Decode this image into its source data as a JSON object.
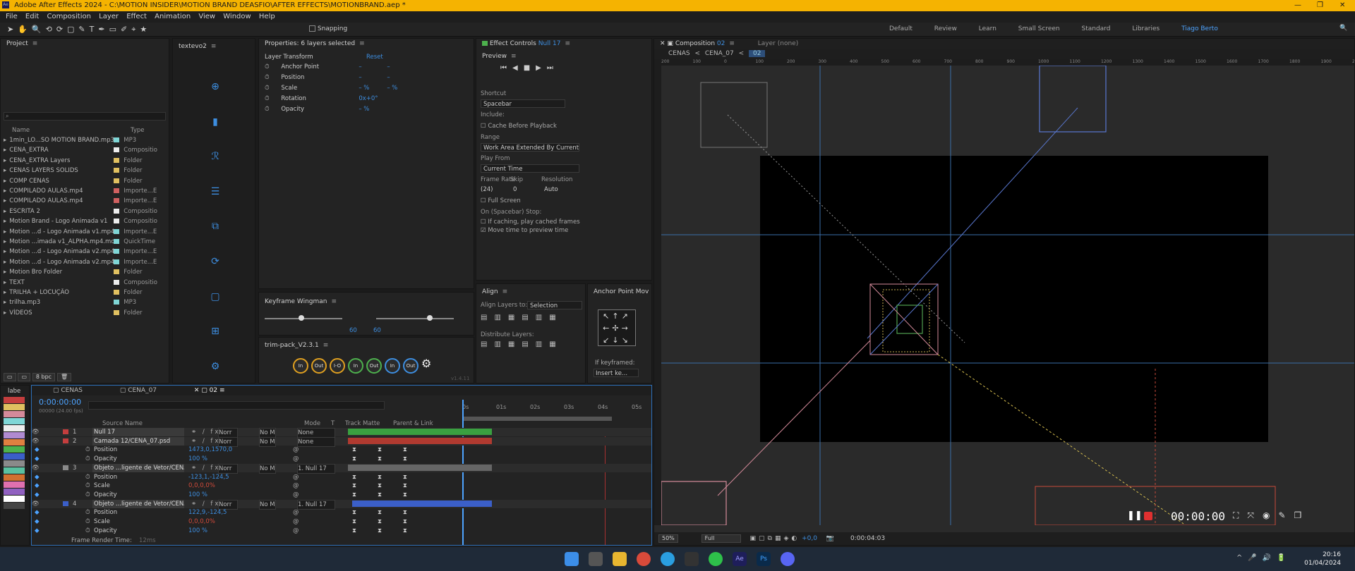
{
  "titlebar": {
    "title": "Adobe After Effects 2024 - C:\\MOTION INSIDER\\MOTION BRAND DEASFIO\\AFTER EFFECTS\\MOTIONBRAND.aep *"
  },
  "menu": [
    "File",
    "Edit",
    "Composition",
    "Layer",
    "Effect",
    "Animation",
    "View",
    "Window",
    "Help"
  ],
  "toolbar": {
    "snapping": "Snapping",
    "workspaces": [
      "Default",
      "Review",
      "Learn",
      "Small Screen",
      "Standard",
      "Libraries",
      "Tiago Berto"
    ],
    "active_workspace": "Tiago Berto"
  },
  "project": {
    "title": "Project",
    "search_placeholder": "",
    "col_name": "Name",
    "col_type": "Type",
    "items": [
      {
        "name": "1min_LO...SO MOTION BRAND.mp3",
        "type": "MP3",
        "color": "#7fd6d6"
      },
      {
        "name": "CENA_EXTRA",
        "type": "Compositio",
        "color": "#ededed"
      },
      {
        "name": "CENA_EXTRA Layers",
        "type": "Folder",
        "color": "#e0c060"
      },
      {
        "name": "CENAS LAYERS SOLIDS",
        "type": "Folder",
        "color": "#e0c060"
      },
      {
        "name": "COMP CENAS",
        "type": "Folder",
        "color": "#e0c060"
      },
      {
        "name": "COMPILADO AULAS.mp4",
        "type": "Importe...E",
        "color": "#d06060"
      },
      {
        "name": "COMPILADO AULAS.mp4",
        "type": "Importe...E",
        "color": "#d06060"
      },
      {
        "name": "ESCRITA 2",
        "type": "Compositio",
        "color": "#ededed"
      },
      {
        "name": "Motion Brand - Logo Animada v1",
        "type": "Compositio",
        "color": "#ededed"
      },
      {
        "name": "Motion ...d - Logo Animada v1.mp4",
        "type": "Importe...E",
        "color": "#7fd6d6"
      },
      {
        "name": "Motion ...imada v1_ALPHA.mp4.mov",
        "type": "QuickTime",
        "color": "#7fd6d6"
      },
      {
        "name": "Motion ...d - Logo Animada v2.mp4",
        "type": "Importe...E",
        "color": "#7fd6d6"
      },
      {
        "name": "Motion ...d - Logo Animada v2.mp4",
        "type": "Importe...E",
        "color": "#7fd6d6"
      },
      {
        "name": "Motion Bro Folder",
        "type": "Folder",
        "color": "#e0c060"
      },
      {
        "name": "TEXT",
        "type": "Compositio",
        "color": "#ededed"
      },
      {
        "name": "TRILHA + LOCUÇÃO",
        "type": "Folder",
        "color": "#e0c060"
      },
      {
        "name": "trilha.mp3",
        "type": "MP3",
        "color": "#7fd6d6"
      },
      {
        "name": "VÍDEOS",
        "type": "Folder",
        "color": "#e0c060"
      }
    ],
    "bpc": "8 bpc"
  },
  "textevo": {
    "title": "textevo2"
  },
  "properties": {
    "title": "Properties: 6 layers selected",
    "section": "Layer Transform",
    "reset": "Reset",
    "rows": [
      {
        "label": "Anchor Point",
        "v1": "–",
        "v2": "–"
      },
      {
        "label": "Position",
        "v1": "–",
        "v2": "–"
      },
      {
        "label": "Scale",
        "v1": "– %",
        "v2": "– %"
      },
      {
        "label": "Rotation",
        "v1": "0x+0°",
        "v2": ""
      },
      {
        "label": "Opacity",
        "v1": "– %",
        "v2": ""
      }
    ]
  },
  "effect_controls": {
    "title": "Effect Controls",
    "layer": "Null 17"
  },
  "preview": {
    "title": "Preview",
    "shortcut_label": "Shortcut",
    "shortcut_value": "Spacebar",
    "include_label": "Include:",
    "cache_label": "Cache Before Playback",
    "range_label": "Range",
    "range_value": "Work Area Extended By Current...",
    "playfrom_label": "Play From",
    "playfrom_value": "Current Time",
    "framerate_label": "Frame Rate",
    "skip_label": "Skip",
    "resolution_label": "Resolution",
    "framerate_value": "(24)",
    "skip_value": "0",
    "resolution_value": "Auto",
    "fullscreen_label": "Full Screen",
    "stop_label": "On (Spacebar) Stop:",
    "stop_opt1": "If caching, play cached frames",
    "stop_opt2": "Move time to preview time"
  },
  "keyframe_wingman": {
    "title": "Keyframe Wingman",
    "v1": "60",
    "v2": "60"
  },
  "trim_pack": {
    "title": "trim-pack_V2.3.1",
    "buttons": [
      "In",
      "Out",
      "I-O",
      "In",
      "Out",
      "In",
      "Out"
    ],
    "version": "v1.4.11"
  },
  "align": {
    "title": "Align",
    "align_to_label": "Align Layers to:",
    "align_to_value": "Selection",
    "distribute_label": "Distribute Layers:"
  },
  "anchor_point": {
    "title": "Anchor Point Mov",
    "if_keyframed": "If keyframed:",
    "insert": "Insert ke..."
  },
  "composition": {
    "title": "Composition",
    "comp_name": "02",
    "layer_panel": "Layer (none)",
    "breadcrumbs": [
      "CENAS",
      "CENA_07",
      "02"
    ],
    "zoom": "50%",
    "quality": "Full",
    "exposure": "+0,0",
    "timecode": "0:00:04:03",
    "ruler": [
      "200",
      "100",
      "0",
      "100",
      "200",
      "300",
      "400",
      "500",
      "600",
      "700",
      "800",
      "900",
      "1000",
      "1100",
      "1200",
      "1300",
      "1400",
      "1500",
      "1600",
      "1700",
      "1800",
      "1900",
      "2000"
    ]
  },
  "recorder": {
    "time": "00:00:00"
  },
  "timeline": {
    "tabs": [
      "CENAS",
      "CENA_07",
      "02"
    ],
    "active_tab": "02",
    "timecode": "0:00:00:00",
    "fps": "00000 (24.00 fps)",
    "columns": {
      "source": "Source Name",
      "mode": "Mode",
      "t": "T",
      "track": "Track Matte",
      "parent": "Parent & Link"
    },
    "ticks": [
      "0s",
      "01s",
      "02s",
      "03s",
      "04s",
      "05s"
    ],
    "layers": [
      {
        "num": "1",
        "name": "Null 17",
        "mode": "Norr",
        "track": "No M",
        "parent": "None",
        "color": "#c43e3e"
      },
      {
        "num": "2",
        "name": "Camada 12/CENA_07.psd",
        "mode": "Norr",
        "track": "No M",
        "parent": "None",
        "color": "#c43e3e"
      },
      {
        "num": "3",
        "name": "Objeto ...ligente de Vetor/CENA_07.psd",
        "mode": "Norr",
        "track": "No M",
        "parent": "1. Null 17",
        "color": "#8a8a8a"
      },
      {
        "num": "4",
        "name": "Objeto ...ligente de Vetor/CENA_07.psd",
        "mode": "Norr",
        "track": "No M",
        "parent": "1. Null 17",
        "color": "#3b5fc8"
      }
    ],
    "props": [
      {
        "label": "Position",
        "value": "1473,0,1570,0",
        "color": "#3d8ee0"
      },
      {
        "label": "Opacity",
        "value": "100 %",
        "color": "#3d8ee0"
      },
      {
        "label": "Position",
        "value": "-123,1,-124,5",
        "color": "#3d8ee0"
      },
      {
        "label": "Scale",
        "value": "0,0,0,0%",
        "color": "#d04a3a"
      },
      {
        "label": "Opacity",
        "value": "100 %",
        "color": "#3d8ee0"
      },
      {
        "label": "Position",
        "value": "122,9,-124,5",
        "color": "#3d8ee0"
      },
      {
        "label": "Scale",
        "value": "0,0,0,0%",
        "color": "#d04a3a"
      },
      {
        "label": "Opacity",
        "value": "100 %",
        "color": "#3d8ee0"
      }
    ],
    "frame_render": "Frame Render Time:",
    "frame_render_value": "12ms",
    "label_panel": "labe"
  },
  "taskbar": {
    "time": "20:16",
    "date": "01/04/2024"
  }
}
